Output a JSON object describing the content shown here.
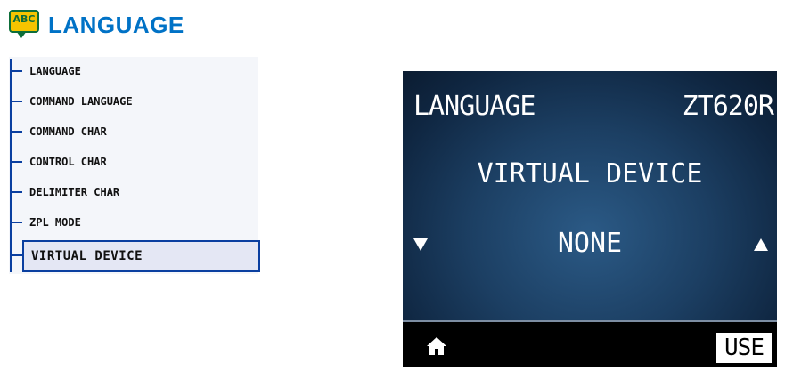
{
  "header": {
    "icon_text": "ABC",
    "title": "LANGUAGE"
  },
  "menu": {
    "items": [
      {
        "label": "LANGUAGE"
      },
      {
        "label": "COMMAND LANGUAGE"
      },
      {
        "label": "COMMAND CHAR"
      },
      {
        "label": "CONTROL CHAR"
      },
      {
        "label": "DELIMITER CHAR"
      },
      {
        "label": "ZPL MODE"
      },
      {
        "label": "VIRTUAL DEVICE",
        "selected": true
      }
    ]
  },
  "screen": {
    "title": "LANGUAGE",
    "model": "ZT620R",
    "setting": "VIRTUAL DEVICE",
    "value": "NONE",
    "action_label": "USE"
  },
  "colors": {
    "accent": "#0072c6",
    "tree": "#0a3fa0",
    "icon_yellow": "#f5c400",
    "icon_green": "#0d6e3a"
  }
}
